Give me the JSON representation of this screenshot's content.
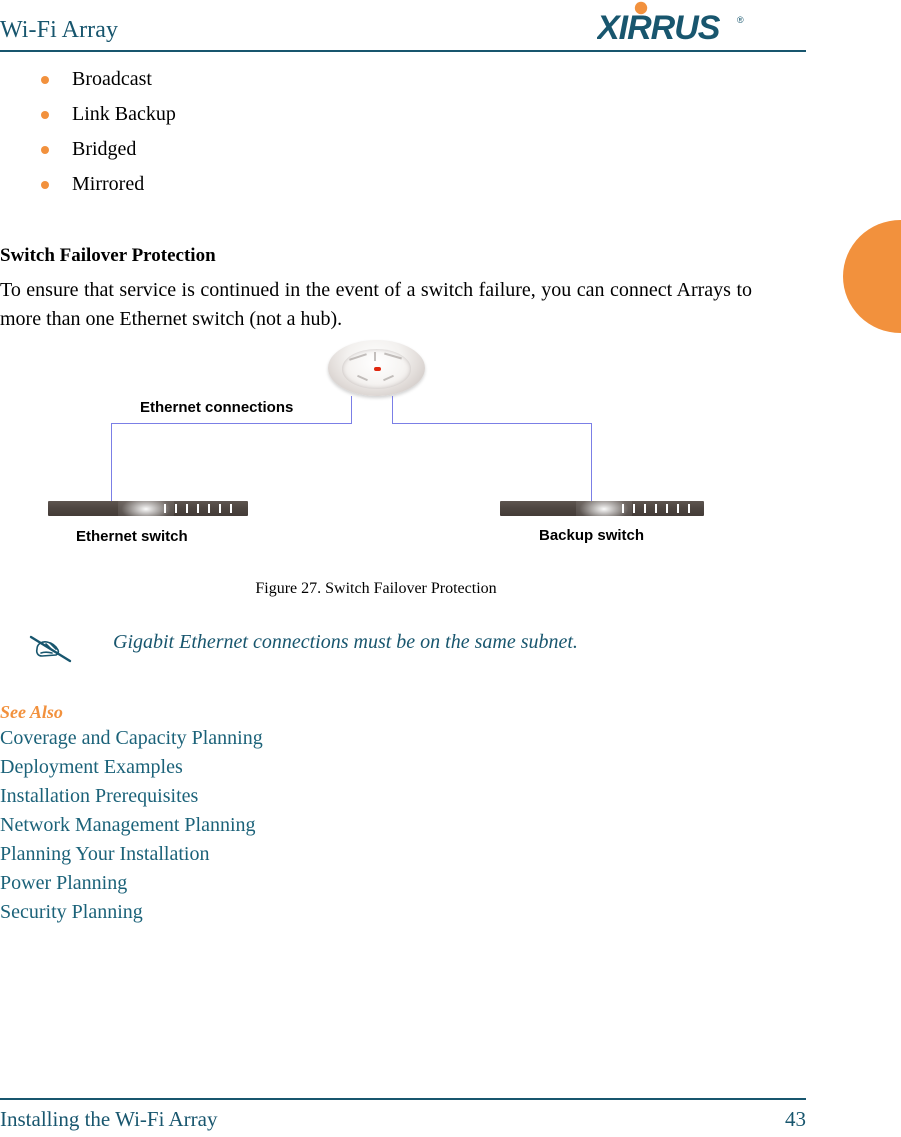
{
  "header": {
    "title": "Wi-Fi Array",
    "logo_text": "XIRRUS",
    "logo_trademark": "®"
  },
  "bullets": [
    {
      "label": "Broadcast"
    },
    {
      "label": "Link Backup"
    },
    {
      "label": "Bridged"
    },
    {
      "label": "Mirrored"
    }
  ],
  "section": {
    "heading": "Switch Failover Protection",
    "paragraph": "To ensure that service is continued in the event of a switch failure, you can connect Arrays to more than one Ethernet switch (not a hub)."
  },
  "figure": {
    "caption": "Figure 27. Switch Failover Protection",
    "labels": {
      "ethernet_connections": "Ethernet connections",
      "ethernet_switch": "Ethernet switch",
      "backup_switch": "Backup switch"
    }
  },
  "note": {
    "icon": "writing-hand-pencil-icon",
    "text": "Gigabit Ethernet connections must be on the same subnet."
  },
  "see_also": {
    "heading": "See Also",
    "links": [
      "Coverage and Capacity Planning",
      "Deployment Examples",
      "Installation Prerequisites",
      "Network Management Planning",
      "Planning Your Installation",
      "Power Planning",
      "Security Planning"
    ]
  },
  "footer": {
    "title": "Installing the Wi-Fi Array",
    "page_number": "43"
  },
  "colors": {
    "brand_teal": "#18566e",
    "brand_orange": "#f2913d",
    "link_teal": "#1b6279",
    "connection_blue": "#7b7fe6",
    "switch_body": "#4e4641",
    "led_red": "#e02810"
  }
}
